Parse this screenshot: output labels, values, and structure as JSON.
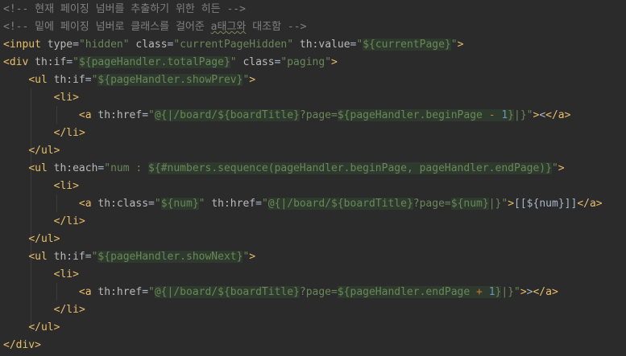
{
  "editor": {
    "lines": [
      {
        "t": "<!-- 현재 페이징 넘버를 추출하기 위한 히든 -->"
      },
      {
        "t": "<!-- 밑에 페이징 넘버로 클래스를 걸어준 a태그와 대조함 -->"
      },
      {
        "t": "<input type=\"hidden\" class=\"currentPageHidden\" th:value=\"${currentPage}\">"
      },
      {
        "t": "<div th:if=\"${pageHandler.totalPage}\" class=\"paging\">"
      },
      {
        "t": "    <ul th:if=\"${pageHandler.showPrev}\">"
      },
      {
        "t": "        <li>"
      },
      {
        "t": "            <a th:href=\"@{|/board/${boardTitle}?page=${pageHandler.beginPage - 1}|}\"><</a>"
      },
      {
        "t": "        </li>"
      },
      {
        "t": "    </ul>"
      },
      {
        "t": "    <ul th:each=\"num : ${#numbers.sequence(pageHandler.beginPage, pageHandler.endPage)}\">"
      },
      {
        "t": "        <li>"
      },
      {
        "t": "            <a th:class=\"${num}\" th:href=\"@{|/board/${boardTitle}?page=${num}|}\">[[${num}]]</a>"
      },
      {
        "t": "        </li>"
      },
      {
        "t": "    </ul>"
      },
      {
        "t": "    <ul th:if=\"${pageHandler.showNext}\">"
      },
      {
        "t": "        <li>"
      },
      {
        "t": "            <a th:href=\"@{|/board/${boardTitle}?page=${pageHandler.endPage + 1}|}\">></a>"
      },
      {
        "t": "        </li>"
      },
      {
        "t": "    </ul>"
      },
      {
        "t": "</div>"
      }
    ]
  }
}
